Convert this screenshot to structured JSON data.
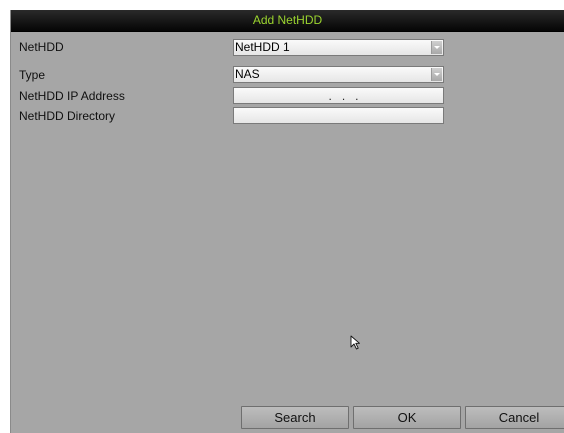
{
  "dialog": {
    "title": "Add NetHDD"
  },
  "form": {
    "nethdd": {
      "label": "NetHDD",
      "value": "NetHDD 1"
    },
    "type": {
      "label": "Type",
      "value": "NAS"
    },
    "ip_address": {
      "label": "NetHDD IP Address",
      "value": "   .   .   ."
    },
    "directory": {
      "label": "NetHDD Directory",
      "value": ""
    }
  },
  "buttons": {
    "search": "Search",
    "ok": "OK",
    "cancel": "Cancel"
  },
  "colors": {
    "title_text": "#9bd42f",
    "panel_bg": "#a6a6a6",
    "titlebar_bg": "#050505"
  },
  "icons": {
    "dropdown": "chevron-down-icon",
    "pointer": "mouse-pointer-icon"
  }
}
